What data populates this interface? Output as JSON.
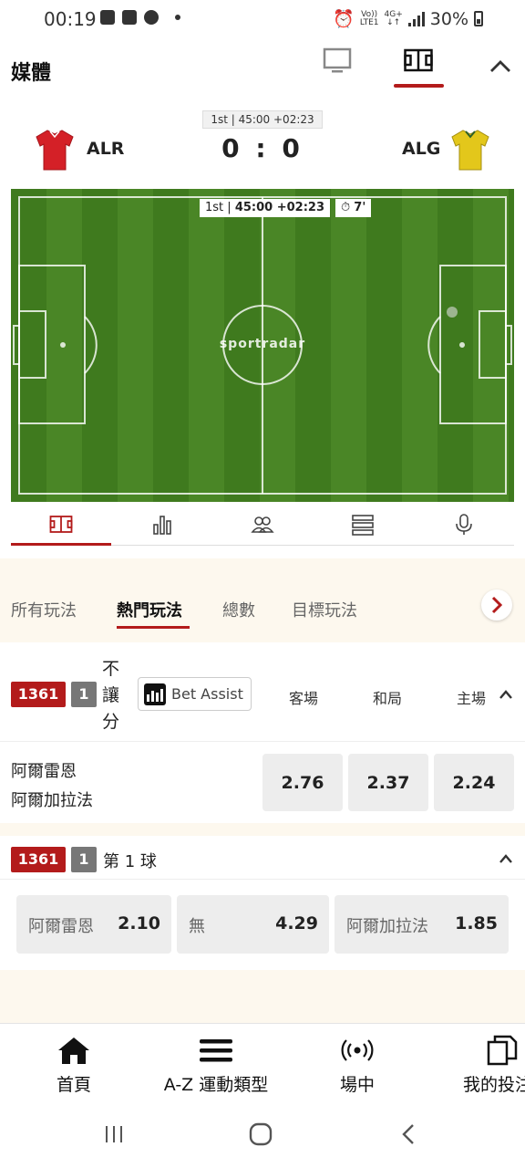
{
  "status_bar": {
    "time": "00:19",
    "battery": "30%",
    "network_top": "Vo))",
    "network_bottom": "LTE1",
    "net_type": "4G+"
  },
  "media": {
    "title": "媒體",
    "tabs": [
      {
        "icon": "tv-icon"
      },
      {
        "icon": "pitch-icon",
        "active": true
      }
    ]
  },
  "match": {
    "clock": "1st | 45:00 +02:23",
    "home_team": "ALR",
    "away_team": "ALG",
    "score": "0 : 0",
    "home_color": "#d42027",
    "away_color": "#e3c71b"
  },
  "field": {
    "period": "1st",
    "time": "45:00 +02:23",
    "added_time": "7'",
    "brand": "sportradar"
  },
  "field_tabs": [
    {
      "icon": "pitch-icon",
      "active": true
    },
    {
      "icon": "stats-icon"
    },
    {
      "icon": "lineup-icon"
    },
    {
      "icon": "list-icon"
    },
    {
      "icon": "microphone-icon"
    }
  ],
  "market_tabs": {
    "items": [
      "所有玩法",
      "熱門玩法",
      "總數",
      "目標玩法"
    ],
    "active_index": 1
  },
  "market1": {
    "event_id": "1361",
    "num": "1",
    "title_chars": [
      "不",
      "讓",
      "分"
    ],
    "bet_assist": "Bet Assist",
    "col_away": "客場",
    "col_draw": "和局",
    "col_home": "主場",
    "team1": "阿爾雷恩",
    "team2": "阿爾加拉法",
    "odds": [
      "2.76",
      "2.37",
      "2.24"
    ]
  },
  "market2": {
    "event_id": "1361",
    "num": "1",
    "title": "第 1 球",
    "options": [
      {
        "label": "阿爾雷恩",
        "value": "2.10"
      },
      {
        "label": "無",
        "value": "4.29"
      },
      {
        "label": "阿爾加拉法",
        "value": "1.85"
      }
    ]
  },
  "bottom_nav": {
    "home": "首頁",
    "az": "A-Z 運動類型",
    "live": "場中",
    "my_bets": "我的投注"
  },
  "colors": {
    "accent": "#b31b1b",
    "cream": "#fdf8ee"
  }
}
